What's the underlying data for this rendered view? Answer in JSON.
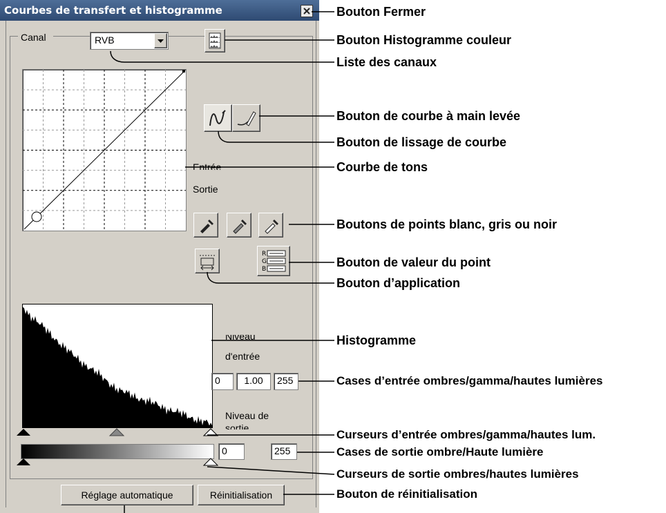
{
  "window": {
    "title": "Courbes de transfert et histogramme"
  },
  "channel": {
    "label": "Canal",
    "selected": "RVB"
  },
  "curve_panel": {
    "input_label": "Entrée",
    "output_label": "Sortie"
  },
  "histogram_panel": {
    "input_level_label": "Niveau d'entrée",
    "input_level_line1": "Niveau",
    "input_level_line2": "d'entrée",
    "input_shadow": "0",
    "input_gamma": "1.00",
    "input_highlight": "255",
    "output_level_line1": "Niveau de",
    "output_level_line2": "sortie",
    "output_shadow": "0",
    "output_highlight": "255"
  },
  "buttons": {
    "auto": "Réglage automatique",
    "reset": "Réinitialisation"
  },
  "callouts": {
    "close": "Bouton Fermer",
    "color_histogram": "Bouton Histogramme couleur",
    "channel_list": "Liste des canaux",
    "freehand": "Bouton de courbe à main levée",
    "smoothing": "Bouton de lissage de courbe",
    "tone_curve": "Courbe de tons",
    "eyedroppers": "Boutons de points blanc, gris ou noir",
    "point_value": "Bouton de valeur du point",
    "apply": "Bouton d’application",
    "histogram": "Histogramme",
    "input_boxes": "Cases d’entrée ombres/gamma/hautes lumières",
    "input_sliders": "Curseurs d’entrée ombres/gamma/hautes lum.",
    "output_boxes": "Cases de sortie ombre/Haute lumière",
    "output_sliders": "Curseurs de sortie ombres/hautes lumières",
    "reset": "Bouton de réinitialisation"
  },
  "icons": [
    "close-icon",
    "color-histogram-icon",
    "dropdown-arrow-icon",
    "freehand-curve-icon",
    "smooth-curve-icon",
    "white-point-eyedropper-icon",
    "gray-point-eyedropper-icon",
    "black-point-eyedropper-icon",
    "apply-icon",
    "point-value-icon"
  ],
  "colors": {
    "dialog_bg": "#d4d0c8",
    "titlebar": "#3a5a86"
  }
}
